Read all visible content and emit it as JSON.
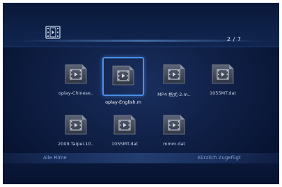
{
  "header": {
    "icon": "film-icon",
    "page_counter": "2 / 7"
  },
  "grid": {
    "items": [
      {
        "label": "oplay-Chinese..",
        "icon": "video-file-icon",
        "selected": false
      },
      {
        "label": "oplay-English.m",
        "icon": "video-file-icon",
        "selected": true
      },
      {
        "label": "MP4 格式-2.m..",
        "icon": "video-file-icon",
        "selected": false
      },
      {
        "label": "1055MT.dat",
        "icon": "video-file-icon",
        "selected": false
      },
      {
        "label": "2009.Taipei.10..",
        "icon": "video-file-icon",
        "selected": false
      },
      {
        "label": "1055MT.dat",
        "icon": "video-file-icon",
        "selected": false
      },
      {
        "label": "mmm.dat",
        "icon": "video-file-icon",
        "selected": false
      }
    ]
  },
  "footer": {
    "left_label": "Alle Filme",
    "right_label": "Kürzlich Zugefügt"
  },
  "colors": {
    "background": "#0f1f45",
    "selection": "#4a8fe8",
    "footer_text": "#7fa3d8"
  }
}
